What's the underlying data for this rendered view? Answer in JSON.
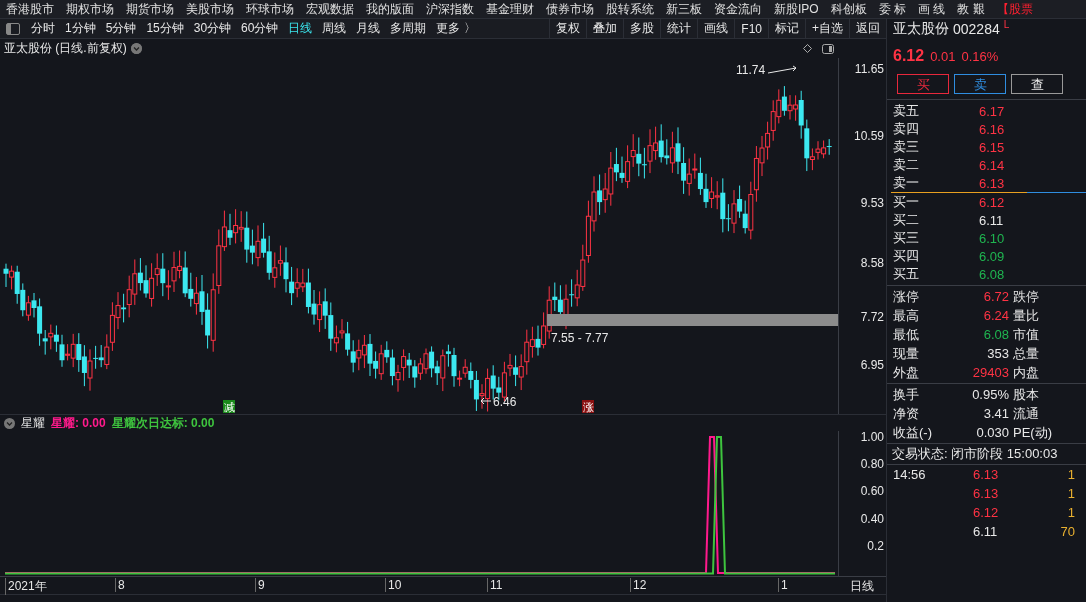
{
  "menu_bar": {
    "items": [
      "香港股市",
      "期权市场",
      "期货市场",
      "美股市场",
      "环球市场",
      "宏观数据",
      "我的版面",
      "沪深指数",
      "基金理财",
      "债券市场",
      "股转系统",
      "新三板",
      "资金流向",
      "新股IPO",
      "科创板",
      "委 标",
      "画 线",
      "教 艱"
    ],
    "highlight": "【股票"
  },
  "toolbar": {
    "periods": [
      {
        "label": "分时",
        "selected": false
      },
      {
        "label": "1分钟",
        "selected": false
      },
      {
        "label": "5分钟",
        "selected": false
      },
      {
        "label": "15分钟",
        "selected": false
      },
      {
        "label": "30分钟",
        "selected": false
      },
      {
        "label": "60分钟",
        "selected": false
      },
      {
        "label": "日线",
        "selected": true
      },
      {
        "label": "周线",
        "selected": false
      },
      {
        "label": "月线",
        "selected": false
      },
      {
        "label": "多周期",
        "selected": false
      },
      {
        "label": "更多 〉",
        "selected": false
      }
    ],
    "tools": [
      "复权",
      "叠加",
      "多股",
      "统计",
      "画线",
      "F10",
      "标记",
      "+自选",
      "返回"
    ]
  },
  "chart": {
    "title": "亚太股份 (日线.前复权)",
    "price_axis": [
      "11.65",
      "10.59",
      "9.53",
      "8.58",
      "7.72",
      "6.95"
    ],
    "high_label": "11.74",
    "low_label": "6.46",
    "band_label": "7.55 - 7.77",
    "signals": [
      {
        "text": "减",
        "kind": "sell"
      },
      {
        "text": "涨",
        "kind": "rise"
      }
    ]
  },
  "indicator": {
    "name": "星耀",
    "values": [
      {
        "label": "星耀: 0.00",
        "color": "#ff1a8c"
      },
      {
        "label": "星耀次日达标: 0.00",
        "color": "#3ec43e"
      }
    ],
    "axis": [
      "1.00",
      "0.80",
      "0.60",
      "0.40",
      "0.2"
    ]
  },
  "x_axis": {
    "labels": [
      "2021年",
      "8",
      "9",
      "10",
      "11",
      "12",
      "1"
    ],
    "period": "日线"
  },
  "quote": {
    "name": "亚太股份",
    "code": "002284",
    "flag": "L",
    "price": "6.12",
    "change": "0.01",
    "change_pct": "0.16%",
    "buttons": [
      {
        "label": "买",
        "kind": "buy"
      },
      {
        "label": "卖",
        "kind": "sell"
      },
      {
        "label": "查",
        "kind": "query"
      }
    ],
    "order_book": [
      {
        "label": "卖五",
        "price": "6.17",
        "color": "#ff3344"
      },
      {
        "label": "卖四",
        "price": "6.16",
        "color": "#ff3344"
      },
      {
        "label": "卖三",
        "price": "6.15",
        "color": "#ff3344"
      },
      {
        "label": "卖二",
        "price": "6.14",
        "color": "#ff3344"
      },
      {
        "label": "卖一",
        "price": "6.13",
        "color": "#ff3344"
      },
      {
        "label": "买一",
        "price": "6.12",
        "color": "#ff3344"
      },
      {
        "label": "买二",
        "price": "6.11",
        "color": "#e8e8e8"
      },
      {
        "label": "买三",
        "price": "6.10",
        "color": "#1fb550"
      },
      {
        "label": "买四",
        "price": "6.09",
        "color": "#1fb550"
      },
      {
        "label": "买五",
        "price": "6.08",
        "color": "#1fb550"
      }
    ],
    "stats": [
      {
        "label": "涨停",
        "value": "6.72",
        "color": "#ff3344",
        "label2": "跌停"
      },
      {
        "label": "最高",
        "value": "6.24",
        "color": "#ff3344",
        "label2": "量比"
      },
      {
        "label": "最低",
        "value": "6.08",
        "color": "#1fb550",
        "label2": "市值"
      },
      {
        "label": "现量",
        "value": "353",
        "color": "#e8e8e8",
        "label2": "总量"
      },
      {
        "label": "外盘",
        "value": "29403",
        "color": "#ff3344",
        "label2": "内盘"
      }
    ],
    "stats2": [
      {
        "label": "换手",
        "value": "0.95%",
        "color": "#e8e8e8",
        "label2": "股本"
      },
      {
        "label": "净资",
        "value": "3.41",
        "color": "#e8e8e8",
        "label2": "流通"
      },
      {
        "label": "收益(-)",
        "value": "0.030",
        "color": "#e8e8e8",
        "label2": "PE(动)"
      }
    ],
    "status": "交易状态: 闭市阶段 15:00:03",
    "ticks": [
      {
        "time": "14:56",
        "price": "6.13",
        "volume": "1",
        "color": "#ff3344"
      },
      {
        "price": "6.13",
        "volume": "1",
        "color": "#ff3344"
      },
      {
        "price": "6.12",
        "volume": "1",
        "color": "#ff3344"
      },
      {
        "price": "6.11",
        "volume": "70",
        "color": "#e8e8e8"
      }
    ]
  }
}
